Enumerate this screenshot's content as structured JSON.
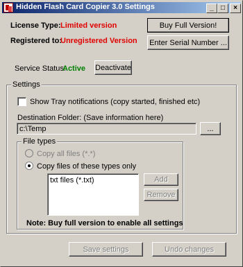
{
  "window": {
    "title": "Hidden Flash Card Copier 3.0 Settings",
    "controls": {
      "minimize": "_",
      "maximize": "□",
      "close": "×"
    }
  },
  "license": {
    "type_label": "License Type:",
    "type_value": "Limited version",
    "registered_label": "Registered to:",
    "registered_value": "Unregistered Version",
    "buy_button": "Buy Full Version!",
    "serial_button": "Enter Serial Number ..."
  },
  "service": {
    "status_label": "Service Status:",
    "status_value": "Active",
    "deactivate_button": "Deactivate"
  },
  "settings": {
    "group_title": "Settings",
    "tray_notifications_label": "Show Tray notifications (copy started, finished etc)",
    "tray_notifications_checked": false,
    "destination_label": "Destination Folder: (Save information here)",
    "destination_value": "c:\\Temp",
    "browse_button": "...",
    "file_types": {
      "group_title": "File types",
      "copy_all_label": "Copy all files (*.*)",
      "copy_types_label": "Copy files of these types only",
      "selected": "copy_types",
      "list_items": [
        "txt files (*.txt)"
      ],
      "add_button": "Add",
      "remove_button": "Remove",
      "note": "Note: Buy full version to enable all settings"
    }
  },
  "footer": {
    "save_button": "Save settings",
    "undo_button": "Undo changes"
  },
  "colors": {
    "license_value": "#e00000",
    "status_active": "#008000",
    "titlebar_start": "#0a246a",
    "titlebar_end": "#a6caf0",
    "face": "#d4d0c8"
  }
}
